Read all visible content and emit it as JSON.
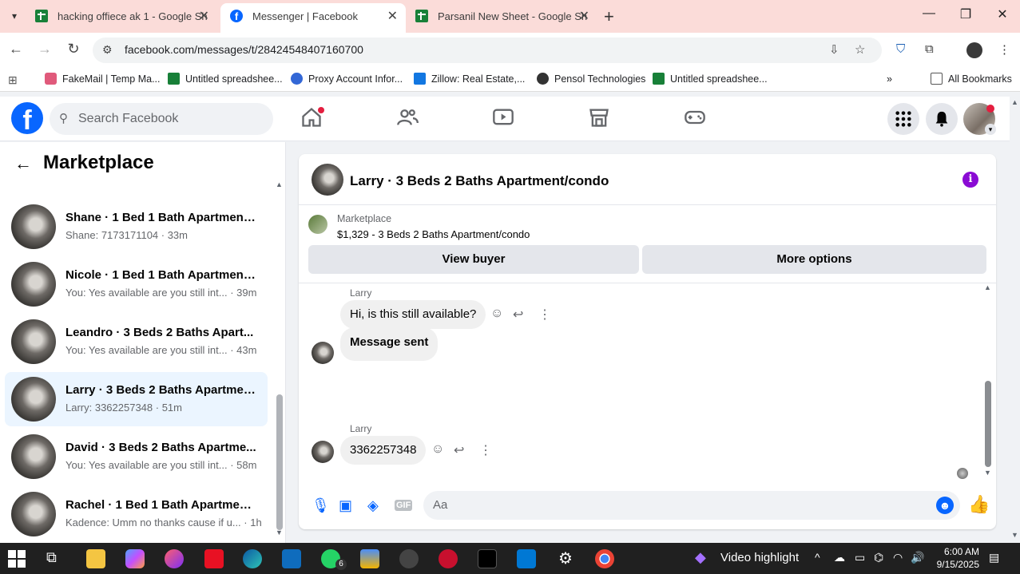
{
  "browser": {
    "tabs": [
      {
        "title": "hacking offiece ak 1 - Google Sh",
        "icon": "sheets-icon"
      },
      {
        "title": "Messenger | Facebook",
        "icon": "facebook-icon"
      },
      {
        "title": "Parsanil New Sheet - Google Sh",
        "icon": "sheets-icon"
      }
    ],
    "url": "facebook.com/messages/t/28424548407160700",
    "bookmarks": [
      {
        "label": "FakeMail | Temp Ma...",
        "color": "#e05a7b"
      },
      {
        "label": "Untitled spreadshee...",
        "color": "#188038"
      },
      {
        "label": "Proxy Account Infor...",
        "color": "#3367d6"
      },
      {
        "label": "Zillow: Real Estate,...",
        "color": "#1277e1"
      },
      {
        "label": "Pensol Technologies",
        "color": "#333333"
      },
      {
        "label": "Untitled spreadshee...",
        "color": "#188038"
      }
    ],
    "all_bookmarks": "All Bookmarks"
  },
  "facebook": {
    "logo": "f",
    "search_placeholder": "Search Facebook"
  },
  "left_panel": {
    "title": "Marketplace",
    "conversations": [
      {
        "name": "Shane · 1 Bed 1 Bath Apartment/...",
        "preview": "Shane: 7173171104 · 33m",
        "active": false
      },
      {
        "name": "Nicole · 1 Bed 1 Bath Apartment/...",
        "preview": "You: Yes available are you still int... · 39m",
        "active": false
      },
      {
        "name": "Leandro · 3 Beds 2 Baths Apart...",
        "preview": "You: Yes available are you still int... · 43m",
        "active": false
      },
      {
        "name": "Larry · 3 Beds 2 Baths Apartmen...",
        "preview": "Larry: 3362257348 · 51m",
        "active": true
      },
      {
        "name": "David · 3 Beds 2 Baths Apartme...",
        "preview": "You: Yes available are you still int... · 58m",
        "active": false
      },
      {
        "name": "Rachel · 1 Bed 1 Bath Apartment...",
        "preview": "Kadence: Umm no thanks cause if u... · 1h",
        "active": false
      }
    ]
  },
  "chat": {
    "title": "Larry · 3 Beds 2 Baths Apartment/condo",
    "marketplace_label": "Marketplace",
    "listing": "$1,329 - 3 Beds 2 Baths Apartment/condo",
    "view_buyer": "View buyer",
    "more_options": "More options",
    "messages": [
      {
        "sender": "Larry",
        "text": "Hi, is this still available?"
      },
      {
        "text": "Message sent"
      },
      {
        "sender": "Larry",
        "text": "3362257348"
      }
    ],
    "composer_placeholder": "Aa"
  },
  "taskbar": {
    "video_highlight": "Video highlight",
    "time": "6:00 AM",
    "date": "9/15/2025",
    "whatsapp_badge": "6"
  }
}
